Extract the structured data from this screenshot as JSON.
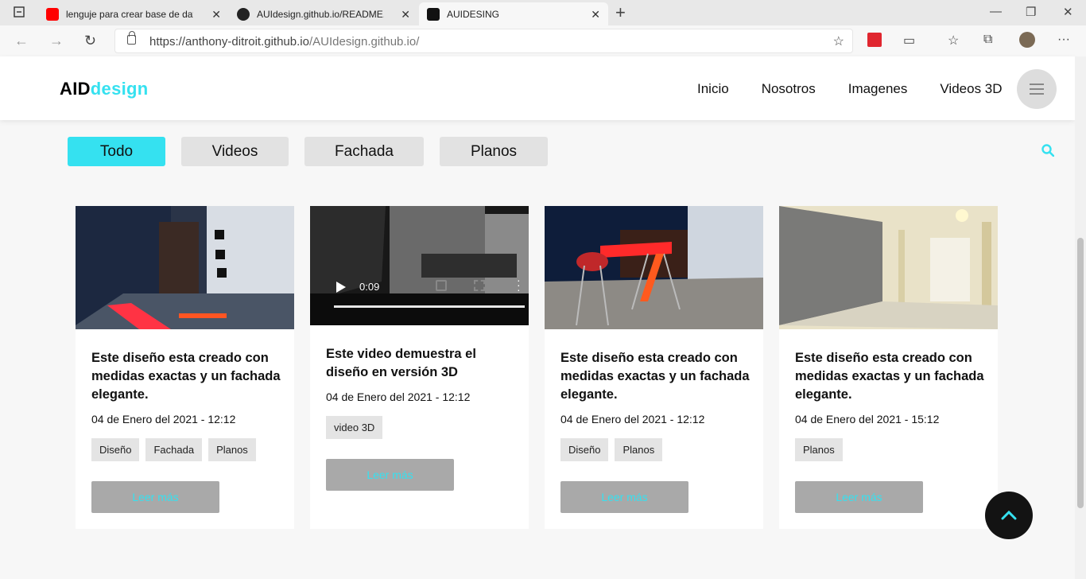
{
  "browser": {
    "tabs": [
      {
        "label": "lenguje para crear base de datos",
        "icon": "youtube-icon"
      },
      {
        "label": "AUIdesign.github.io/README.md",
        "icon": "github-icon"
      },
      {
        "label": "AUIDESING",
        "icon": "site-icon"
      }
    ],
    "url_host": "https://anthony-ditroit.github.io",
    "url_path": "/AUIdesign.github.io/"
  },
  "site": {
    "logo_bold": "AID",
    "logo_color": "design",
    "menu": [
      "Inicio",
      "Nosotros",
      "Imagenes",
      "Videos 3D"
    ]
  },
  "filters": [
    "Todo",
    "Videos",
    "Fachada",
    "Planos"
  ],
  "cards": [
    {
      "title": "Este diseño esta creado con medidas exactas y un fachada elegante.",
      "date": "04 de Enero del 2021 - 12:12",
      "tags": [
        "Diseño",
        "Fachada",
        "Planos"
      ],
      "button": "Leer más"
    },
    {
      "title": "Este video demuestra el diseño en versión 3D",
      "date": "04 de Enero del 2021 - 12:12",
      "tags": [
        "video 3D"
      ],
      "button": "Leer más",
      "video_time": "0:09"
    },
    {
      "title": "Este diseño esta creado con medidas exactas y un fachada elegante.",
      "date": "04 de Enero del 2021 - 12:12",
      "tags": [
        "Diseño",
        "Planos"
      ],
      "button": "Leer más"
    },
    {
      "title": "Este diseño esta creado con medidas exactas y un fachada elegante.",
      "date": "04 de Enero del 2021 - 15:12",
      "tags": [
        "Planos"
      ],
      "button": "Leer más"
    }
  ],
  "colors": {
    "accent": "#35e1f0",
    "button": "#a9a9a9"
  }
}
